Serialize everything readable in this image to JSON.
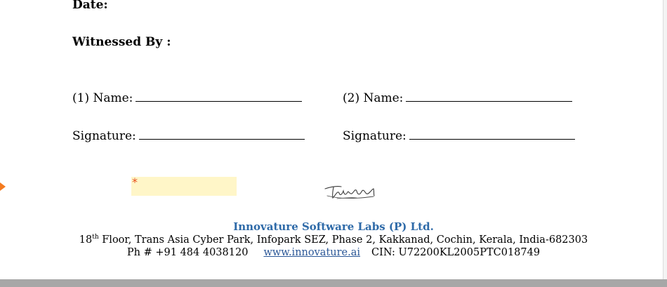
{
  "form": {
    "date_label": "Date:",
    "witnessed_label": "Witnessed By :",
    "name1_label": "(1) Name:",
    "name2_label": "(2) Name:",
    "signature1_label": "Signature:",
    "signature2_label": "Signature:",
    "required_marker": "*"
  },
  "footer": {
    "company": "Innovature Software Labs (P) Ltd.",
    "address_prefix": "18",
    "address_sup": "th",
    "address_rest": " Floor, Trans Asia Cyber Park, Infopark SEZ, Phase 2, Kakkanad, Cochin, Kerala, India-682303",
    "phone": "Ph # +91 484 4038120",
    "website": "www.innovature.ai",
    "cin": "CIN: U72200KL2005PTC018749"
  },
  "colors": {
    "company": "#2e6aa8",
    "link": "#2b5797",
    "sign_field_bg": "#fff6c8",
    "required_marker": "#e8501e",
    "nav_arrow": "#f47b20"
  },
  "icons": {
    "nav_arrow": "next-field-arrow-icon",
    "signature": "handwritten-signature-image"
  }
}
